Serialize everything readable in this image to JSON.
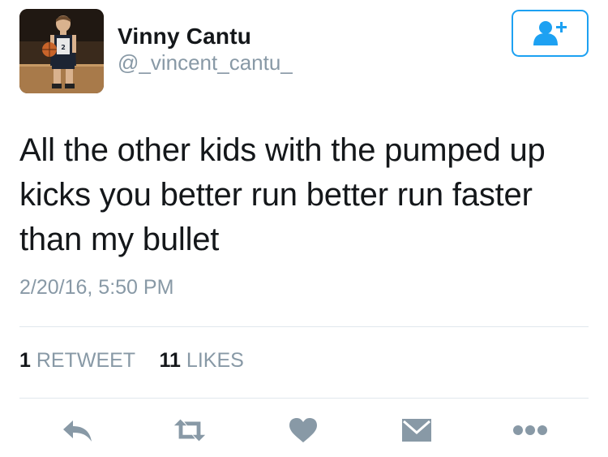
{
  "user": {
    "name": "Vinny Cantu",
    "handle": "@_vincent_cantu_",
    "avatar_icon": "user-photo-basketball-player"
  },
  "follow_button": {
    "icon": "add-user-icon",
    "color": "#1da1f2"
  },
  "tweet": {
    "text": "All the other kids with the pumped up kicks you better run better run faster than my bullet",
    "timestamp": "2/20/16, 5:50 PM"
  },
  "stats": {
    "retweet_count": "1",
    "retweet_label": "RETWEET",
    "like_count": "11",
    "like_label": "LIKES"
  },
  "actions": [
    {
      "name": "reply",
      "icon": "reply-icon"
    },
    {
      "name": "retweet",
      "icon": "retweet-icon"
    },
    {
      "name": "like",
      "icon": "heart-icon"
    },
    {
      "name": "direct-message",
      "icon": "envelope-icon"
    },
    {
      "name": "more",
      "icon": "more-dots-icon"
    }
  ],
  "colors": {
    "text": "#14171a",
    "secondary": "#8899a6",
    "accent": "#1da1f2",
    "divider": "#e1e8ed"
  }
}
